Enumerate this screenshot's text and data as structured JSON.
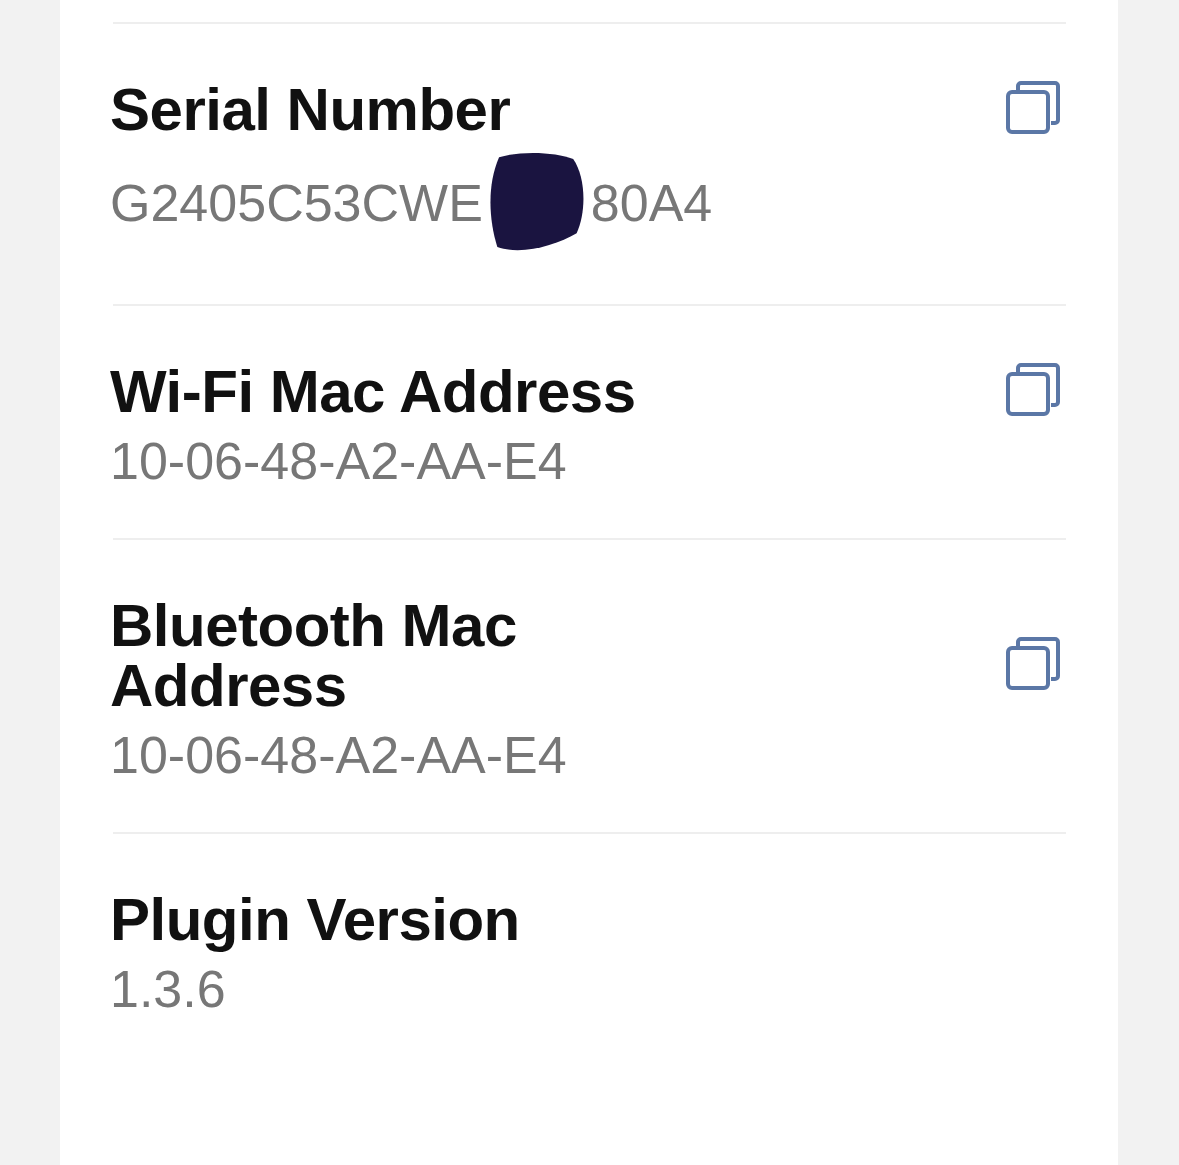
{
  "rows": [
    {
      "title": "Serial Number",
      "value_parts": [
        "G2405C53CWE",
        "80A4"
      ],
      "redacted": true,
      "copyable": true
    },
    {
      "title": "Wi-Fi Mac Address",
      "value_parts": [
        "10-06-48-A2-AA-E4"
      ],
      "copyable": true
    },
    {
      "title": "Bluetooth Mac Address",
      "value_parts": [
        "10-06-48-A2-AA-E4"
      ],
      "copyable": true
    },
    {
      "title": "Plugin Version",
      "value_parts": [
        "1.3.6"
      ]
    }
  ]
}
